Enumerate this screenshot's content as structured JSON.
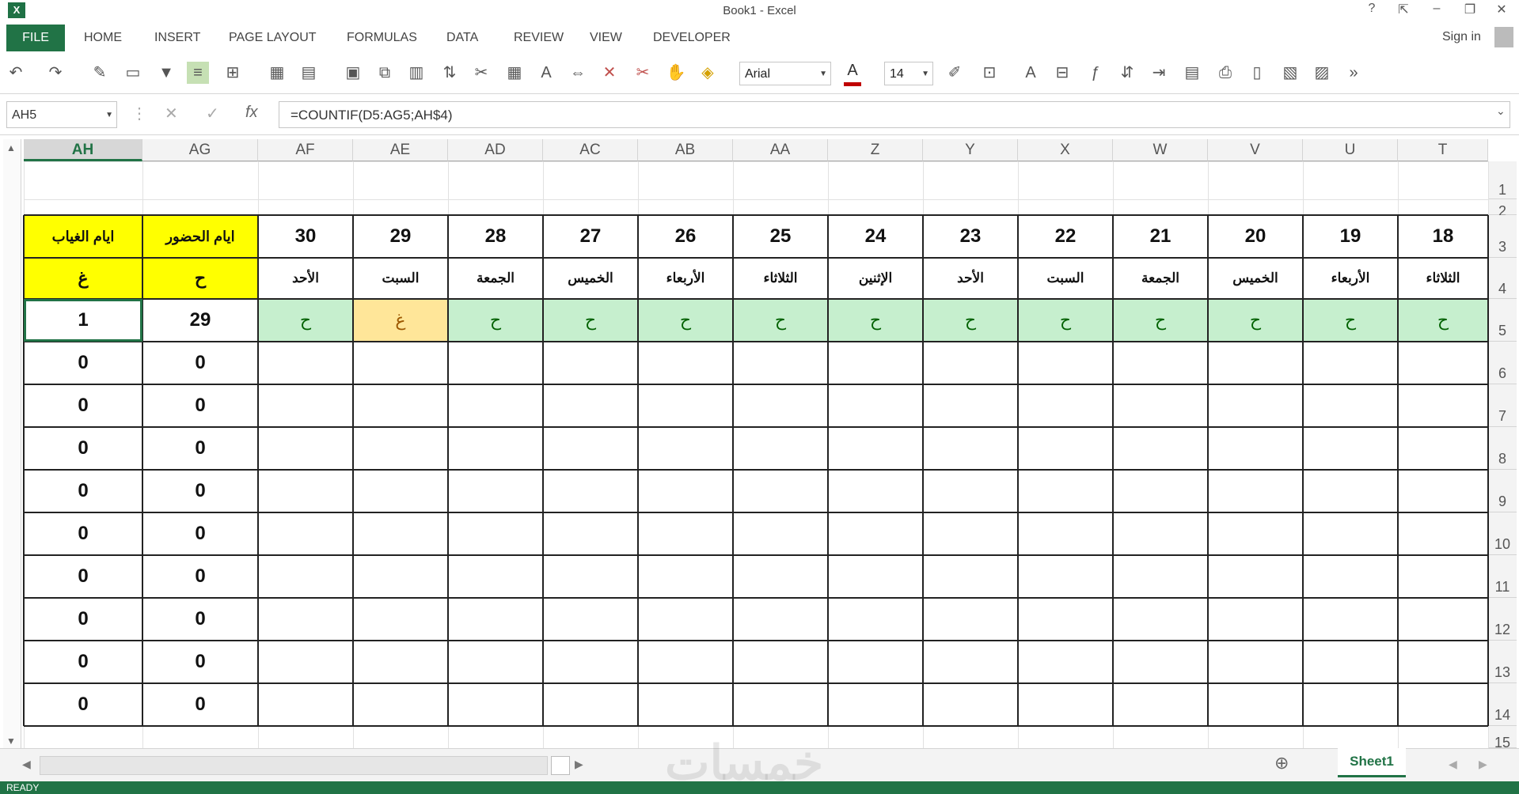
{
  "window": {
    "title": "Book1 - Excel",
    "app_icon": "X",
    "help": "?",
    "signin": "Sign in"
  },
  "ribbon": {
    "file": "FILE",
    "tabs": [
      "HOME",
      "INSERT",
      "PAGE LAYOUT",
      "FORMULAS",
      "DATA",
      "REVIEW",
      "VIEW",
      "DEVELOPER"
    ]
  },
  "toolbar": {
    "font": "Arial",
    "size": "14",
    "icons": [
      "undo-icon",
      "redo-icon",
      "edit-icon",
      "open-icon",
      "filter-icon",
      "align-icon",
      "borders-icon",
      "calculator-icon",
      "format-icon",
      "insert-icon",
      "copy-icon",
      "chart-icon",
      "sort-icon",
      "cut-icon",
      "table-icon",
      "font-size-icon",
      "merge-icon",
      "clear-icon",
      "delete-icon",
      "paste-icon",
      "fill-color-icon"
    ]
  },
  "formula_bar": {
    "namebox": "AH5",
    "formula": "=COUNTIF(D5:AG5;AH$4)",
    "cancel": "✕",
    "enter": "✓",
    "fx": "fx"
  },
  "columns": [
    "AH",
    "AG",
    "AF",
    "AE",
    "AD",
    "AC",
    "AB",
    "AA",
    "Z",
    "Y",
    "X",
    "W",
    "V",
    "U",
    "T"
  ],
  "active_column": "AH",
  "rows": [
    "1",
    "2",
    "3",
    "4",
    "5",
    "6",
    "7",
    "8",
    "9",
    "10",
    "11",
    "12",
    "13",
    "14",
    "15"
  ],
  "summary_headers": {
    "absence": "ايام الغياب",
    "presence": "ايام الحضور",
    "absence_code": "غ",
    "presence_code": "ح"
  },
  "days": [
    {
      "num": "30",
      "name": "الأحد",
      "mark": "ح"
    },
    {
      "num": "29",
      "name": "السبت",
      "mark": "غ"
    },
    {
      "num": "28",
      "name": "الجمعة",
      "mark": "ح"
    },
    {
      "num": "27",
      "name": "الخميس",
      "mark": "ح"
    },
    {
      "num": "26",
      "name": "الأربعاء",
      "mark": "ح"
    },
    {
      "num": "25",
      "name": "الثلاثاء",
      "mark": "ح"
    },
    {
      "num": "24",
      "name": "الإثنين",
      "mark": "ح"
    },
    {
      "num": "23",
      "name": "الأحد",
      "mark": "ح"
    },
    {
      "num": "22",
      "name": "السبت",
      "mark": "ح"
    },
    {
      "num": "21",
      "name": "الجمعة",
      "mark": "ح"
    },
    {
      "num": "20",
      "name": "الخميس",
      "mark": "ح"
    },
    {
      "num": "19",
      "name": "الأربعاء",
      "mark": "ح"
    },
    {
      "num": "18",
      "name": "الثلاثاء",
      "mark": "ح"
    }
  ],
  "totals": [
    {
      "absence": "1",
      "presence": "29"
    },
    {
      "absence": "0",
      "presence": "0"
    },
    {
      "absence": "0",
      "presence": "0"
    },
    {
      "absence": "0",
      "presence": "0"
    },
    {
      "absence": "0",
      "presence": "0"
    },
    {
      "absence": "0",
      "presence": "0"
    },
    {
      "absence": "0",
      "presence": "0"
    },
    {
      "absence": "0",
      "presence": "0"
    },
    {
      "absence": "0",
      "presence": "0"
    },
    {
      "absence": "0",
      "presence": "0"
    }
  ],
  "colors": {
    "excel_green": "#217346",
    "header_yellow": "#ffff00",
    "present_green": "#c6efce",
    "absent_orange": "#ffe699",
    "present_text": "#006100",
    "absent_text": "#9c5700"
  },
  "sheet_tabs": [
    "Sheet1"
  ],
  "status": "READY",
  "watermark": "خمسات"
}
